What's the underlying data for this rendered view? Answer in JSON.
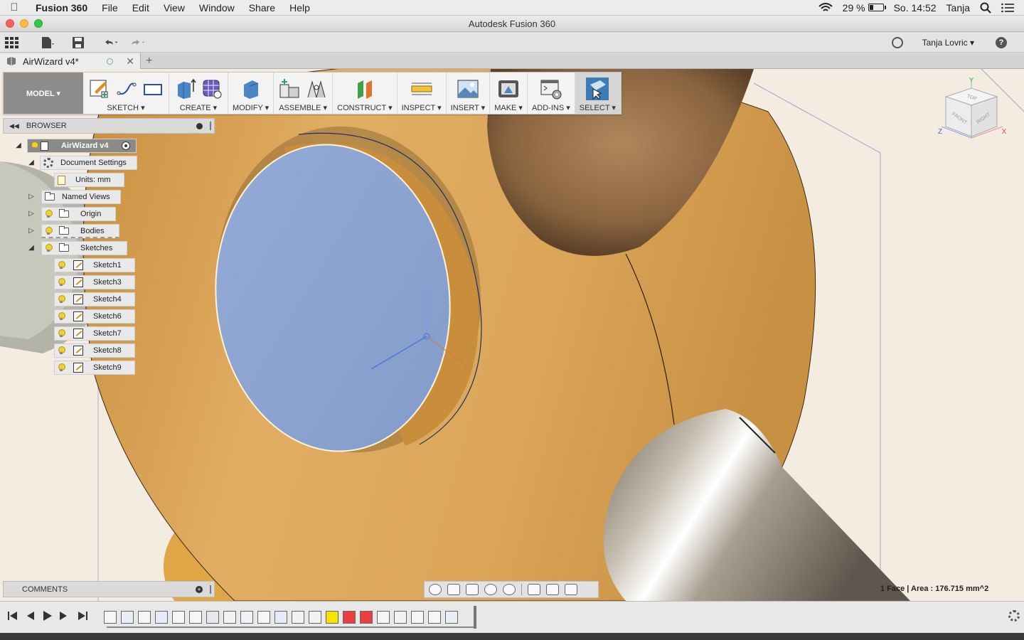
{
  "menubar": {
    "app_name": "Fusion 360",
    "menus": [
      "File",
      "Edit",
      "View",
      "Window",
      "Share",
      "Help"
    ],
    "battery_percent": "29 %",
    "battery_level": 0.29,
    "clock": "So. 14:52",
    "user": "Tanja"
  },
  "window": {
    "title": "Autodesk Fusion 360"
  },
  "app_toolbar": {
    "user_label": "Tanja Lovric ▾",
    "help_label": "?"
  },
  "doc_tab": {
    "name": "AirWizard v4*",
    "new_tab": "+"
  },
  "ribbon": {
    "mode": "MODEL ▾",
    "groups": [
      {
        "label": "SKETCH ▾"
      },
      {
        "label": "CREATE ▾"
      },
      {
        "label": "MODIFY ▾"
      },
      {
        "label": "ASSEMBLE ▾"
      },
      {
        "label": "CONSTRUCT ▾"
      },
      {
        "label": "INSPECT ▾"
      },
      {
        "label": "INSERT ▾"
      },
      {
        "label": "MAKE ▾"
      },
      {
        "label": "ADD-INS ▾"
      },
      {
        "label": "SELECT ▾"
      }
    ]
  },
  "browser": {
    "title": "BROWSER",
    "root": "AirWizard v4",
    "document_settings": "Document Settings",
    "units": "Units: mm",
    "named_views": "Named Views",
    "origin": "Origin",
    "bodies": "Bodies",
    "sketches": "Sketches",
    "sketch_items": [
      "Sketch1",
      "Sketch3",
      "Sketch4",
      "Sketch6",
      "Sketch7",
      "Sketch8",
      "Sketch9"
    ]
  },
  "viewcube": {
    "top": "TOP",
    "front": "FRONT",
    "right": "RIGHT",
    "axis_x": "X",
    "axis_y": "Y",
    "axis_z": "Z"
  },
  "comments": {
    "title": "COMMENTS"
  },
  "status": {
    "selection": "1 Face | Area : 176.715 mm^2"
  },
  "colors": {
    "wood": "#dca55a",
    "face_selected": "#8ea7d4",
    "metal": "#b8b0a0",
    "viewport_bg": "#f4ece1"
  }
}
